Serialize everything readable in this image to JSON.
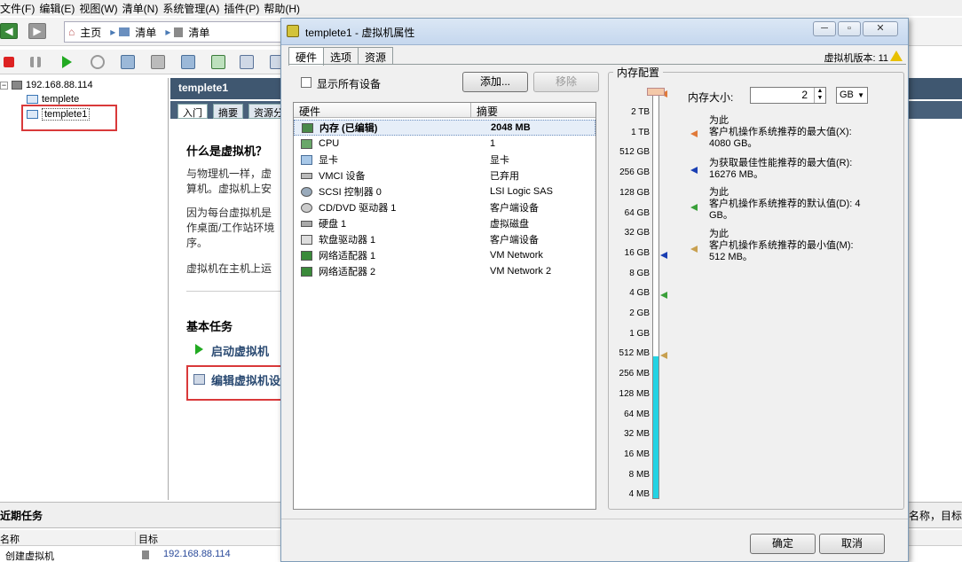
{
  "menu": [
    "文件(F)",
    "编辑(E)",
    "视图(W)",
    "清单(N)",
    "系统管理(A)",
    "插件(P)",
    "帮助(H)"
  ],
  "nav": {
    "home": "主页",
    "inventory1": "清单",
    "inventory2": "清单"
  },
  "tree": {
    "host": "192.168.88.114",
    "vm1": "templete",
    "vm2": "templete1"
  },
  "main": {
    "title": "templete1",
    "tabs": [
      "入门",
      "摘要",
      "资源分"
    ],
    "heading": "什么是虚拟机？",
    "p1a": "与物理机一样，虚",
    "p1b": "算机。虚拟机上安",
    "p2a": "因为每台虚拟机是",
    "p2b": "作桌面/工作站环境",
    "p2c": "序。",
    "p3": "虚拟机在主机上运",
    "basic_tasks": "基本任务",
    "task_start": "启动虚拟机",
    "task_edit": "编辑虚拟机设"
  },
  "bottom": {
    "recent_tasks": "近期任务",
    "col_name": "名称",
    "col_target": "目标",
    "row_task": "创建虚拟机",
    "row_target": "192.168.88.114",
    "right_hint": "名称，目标"
  },
  "dialog": {
    "title": "templete1 - 虚拟机属性",
    "tabs": [
      "硬件",
      "选项",
      "资源"
    ],
    "version": "虚拟机版本: 11",
    "show_all": "显示所有设备",
    "add": "添加...",
    "remove": "移除",
    "col_hw": "硬件",
    "col_summary": "摘要",
    "hardware": [
      {
        "name": "内存 (已编辑)",
        "summary": "2048 MB"
      },
      {
        "name": "CPU",
        "summary": "1"
      },
      {
        "name": "显卡",
        "summary": "显卡"
      },
      {
        "name": "VMCI 设备",
        "summary": "已弃用"
      },
      {
        "name": "SCSI 控制器 0",
        "summary": "LSI Logic SAS"
      },
      {
        "name": "CD/DVD 驱动器 1",
        "summary": "客户端设备"
      },
      {
        "name": "硬盘 1",
        "summary": "虚拟磁盘"
      },
      {
        "name": "软盘驱动器 1",
        "summary": "客户端设备"
      },
      {
        "name": "网络适配器 1",
        "summary": "VM Network"
      },
      {
        "name": "网络适配器 2",
        "summary": "VM Network 2"
      }
    ],
    "memory": {
      "group_title": "内存配置",
      "size_label": "内存大小:",
      "size_value": "2",
      "unit": "GB",
      "ticks": [
        "2 TB",
        "1 TB",
        "512 GB",
        "256 GB",
        "128 GB",
        "64 GB",
        "32 GB",
        "16 GB",
        "8 GB",
        "4 GB",
        "2 GB",
        "1 GB",
        "512 MB",
        "256 MB",
        "128 MB",
        "64 MB",
        "32 MB",
        "16 MB",
        "8 MB",
        "4 MB"
      ],
      "rec_max_1": "为此",
      "rec_max_2": "客户机操作系统推荐的最大值(X):",
      "rec_max_3": "4080 GB。",
      "rec_best_1": "为获取最佳性能推荐的最大值(R):",
      "rec_best_2": "16276 MB。",
      "rec_def_1": "为此",
      "rec_def_2": "客户机操作系统推荐的默认值(D): 4",
      "rec_def_3": "GB。",
      "rec_min_1": "为此",
      "rec_min_2": "客户机操作系统推荐的最小值(M):",
      "rec_min_3": "512 MB。",
      "colors": {
        "max": "#e07a3a",
        "best": "#1a3fb3",
        "default": "#3aa03a",
        "min": "#c8a050",
        "fill": "#23d3e3"
      }
    },
    "ok": "确定",
    "cancel": "取消"
  }
}
